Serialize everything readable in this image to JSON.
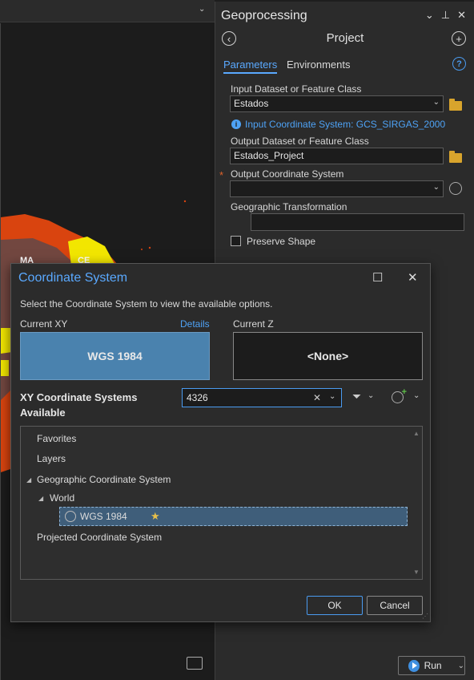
{
  "gp_pane": {
    "title": "Geoprocessing",
    "tool_name": "Project",
    "tabs": [
      "Parameters",
      "Environments"
    ],
    "params": {
      "input_label": "Input Dataset or Feature Class",
      "input_value": "Estados",
      "info_text": "Input Coordinate System: GCS_SIRGAS_2000",
      "output_label": "Output Dataset or Feature Class",
      "output_value": "Estados_Project",
      "ocs_label": "Output Coordinate System",
      "ocs_value": "",
      "geo_trans_label": "Geographic Transformation",
      "preserve_label": "Preserve Shape"
    },
    "run_label": "Run"
  },
  "map": {
    "labels": [
      "MA",
      "CE"
    ]
  },
  "dialog": {
    "title": "Coordinate System",
    "instruction": "Select the Coordinate System to view the available options.",
    "current_xy_label": "Current XY",
    "details_link": "Details",
    "current_xy_value": "WGS 1984",
    "current_z_label": "Current Z",
    "current_z_value": "<None>",
    "available_label": "XY Coordinate Systems Available",
    "search_value": "4326",
    "tree": {
      "favorites": "Favorites",
      "layers": "Layers",
      "geographic": "Geographic Coordinate System",
      "world": "World",
      "selected": "WGS 1984",
      "projected": "Projected Coordinate System"
    },
    "ok_label": "OK",
    "cancel_label": "Cancel"
  },
  "colors": {
    "accent": "#5aa9ff",
    "selection": "#4a82ae",
    "map_red": "#d9440f",
    "map_yellow": "#f2e600"
  }
}
